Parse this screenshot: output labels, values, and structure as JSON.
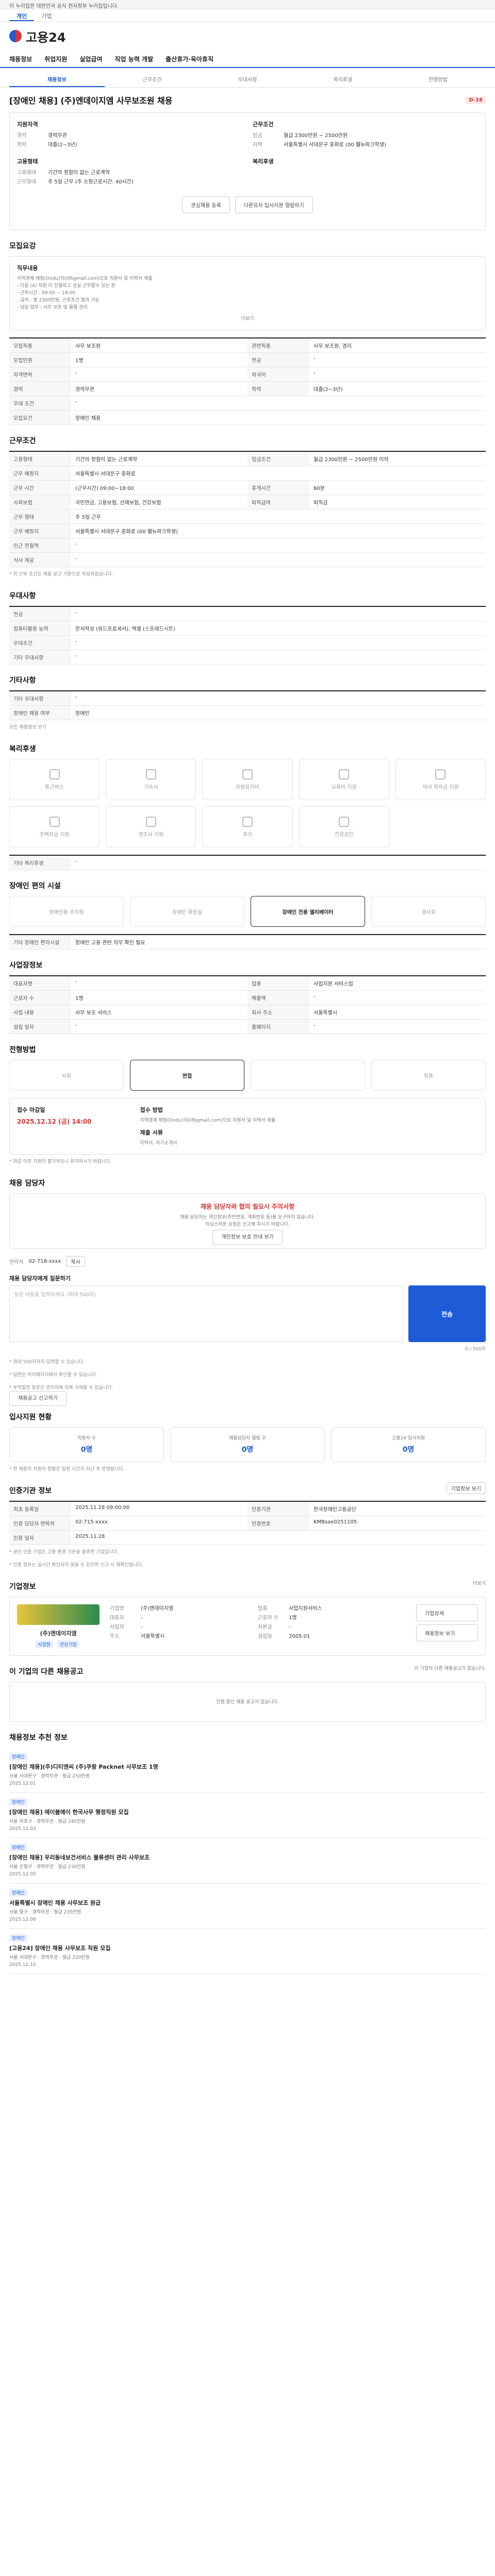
{
  "top": {
    "notice": "이 누리집은 대한민국 공식 전자정부 누리집입니다.",
    "tabs": [
      "개인",
      "기업"
    ]
  },
  "site": {
    "name": "고용24"
  },
  "gnb": [
    "채용정보",
    "취업지원",
    "실업급여",
    "직업 능력 개발",
    "출산휴가·육아휴직"
  ],
  "subtabs": [
    "채용정보",
    "근무조건",
    "우대사항",
    "복리후생",
    "전형방법"
  ],
  "job": {
    "title": "[장애인 채용] (주)엔데이지엠 사무보조원 채용",
    "badge": "D-18"
  },
  "summary": {
    "left_label": "지원자격",
    "right_label": "근무조건",
    "left": [
      [
        "경력",
        "경력무관"
      ],
      [
        "학력",
        "대졸(2~3년)"
      ]
    ],
    "right": [
      [
        "임금",
        "월급 2300만원 ~ 2500만원"
      ],
      [
        "지역",
        "서울특별시 서대문구 중화로 (00 웰뉴파크학생)"
      ]
    ],
    "left2_label": "고용형태",
    "right2_label": "복리후생",
    "left2": [
      [
        "고용형태",
        "기간의 정함이 없는 근로계약"
      ],
      [
        "근무형태",
        "주 5일 근무 (주 소정근로시간: 40시간)"
      ]
    ]
  },
  "actions": {
    "apply": "관심채용 등록",
    "share": "다른유저 입사지원 열람하기"
  },
  "sec_req": {
    "title": "모집요강",
    "duties_label": "직무내용",
    "duties": [
      "지역경제 체험(Ondu)의(lifbgmail.com)으로 지원서 및 이력서 제출",
      "- 다음 (4) 직원 이 친절하고 성실 근무할수 있는 분",
      "- 근무시간 : 09:00 ~ 18:00",
      "- 급여 : 월 2300만원, 근로조건 협의 가능",
      "- 담당 업무 : 사무 보조 및 물품 관리"
    ],
    "more": "더보기",
    "rows": [
      [
        "모집직종",
        "사무 보조원",
        "관련직종",
        "사무 보조원, 경리"
      ],
      [
        "모집인원",
        "1명",
        "전공",
        "-"
      ],
      [
        "자격면허",
        "-",
        "외국어",
        "-"
      ],
      [
        "경력",
        "경력무관",
        "학력",
        "대졸(2~3년)"
      ],
      [
        "우대 조건",
        "-",
        "",
        " "
      ],
      [
        "모집요건",
        "장애인 채용",
        "",
        ""
      ]
    ]
  },
  "sec_cond": {
    "title": "근무조건",
    "rows": [
      [
        "고용형태",
        "기간의 정함이 없는 근로계약",
        "임금조건",
        "월급 2300만원 ~ 2500만원 이하"
      ],
      [
        "근무 예정지",
        "서울특별시 서대문구 중화로",
        "",
        ""
      ],
      [
        "근무 시간",
        "(근무시간) 09:00~18:00",
        "휴게시간",
        "60분"
      ],
      [
        "사회보험",
        "국민연금, 고용보험, 산재보험, 건강보험",
        "퇴직급여",
        "퇴직금"
      ],
      [
        "근무 형태",
        "주 5일 근무",
        "",
        ""
      ],
      [
        "근무 예정지",
        "서울특별시 서대문구 중화로 (00 웰뉴파크학생)",
        "",
        ""
      ],
      [
        "인근 전철역",
        "-",
        "",
        ""
      ],
      [
        "식사 제공",
        "-",
        "",
        ""
      ]
    ],
    "note": "* 위 근무 조건은 채용 공고 기준으로 작성되었습니다."
  },
  "sec_pref": {
    "title": "우대사항",
    "rows": [
      [
        "전공",
        "-"
      ],
      [
        "컴퓨터활용 능력",
        "문서작성 (워드프로세서), 엑셀 (스프레드시트)"
      ],
      [
        "우대조건",
        "-"
      ],
      [
        "기타 우대사항",
        "-"
      ]
    ]
  },
  "sec_etc": {
    "title": "기타사항",
    "rows": [
      [
        "기타 우대사항",
        "-"
      ],
      [
        "장애인 채용 여부",
        "장애인"
      ]
    ],
    "link": "모든 채용정보 보기"
  },
  "sec_welfare": {
    "title": "복리후생",
    "items": [
      "통근버스",
      "기숙사",
      "차량유지비",
      "교육비 지원",
      "자녀 학자금 지원",
      "주택자금 지원",
      "경조사 지원",
      "휴가",
      "건강검진"
    ],
    "other_label": "기타 복리후생",
    "other_value": "-"
  },
  "sec_disab": {
    "title": "장애인 편의 시설",
    "items": [
      "장애인용 주차장",
      "장애인 화장실",
      "장애인 전용 엘리베이터",
      "경사로"
    ],
    "other_label": "기타 장애인 편의시설",
    "other_value": "장애인 고용 관련 의무 확인 필요"
  },
  "sec_co": {
    "title": "사업장정보",
    "rows": [
      [
        "대표자명",
        "-",
        "업종",
        "사업지원 서비스업"
      ],
      [
        "근로자 수",
        "1명",
        "매출액",
        "-"
      ],
      [
        "사업 내용",
        "사무 보조 서비스",
        "회사 주소",
        "서울특별시"
      ],
      [
        "설립 일자",
        "-",
        "홈페이지",
        "-"
      ]
    ]
  },
  "sec_sel": {
    "title": "전형방법",
    "steps": [
      "서류",
      "면접",
      "",
      "최종"
    ],
    "deadline_label": "접수 마감일",
    "deadline": "2025.12.12 (금) 14:00",
    "method_label": "접수 방법",
    "method": "지역경제 체험(Ondu)의(lifbgmail.com)으로 지원서 및 이력서 제출",
    "docs_label": "제출 서류",
    "docs": "이력서, 자기소개서",
    "note": "* 마감 이후 지원이 불가하오니 유의하시기 바랍니다."
  },
  "sec_contact": {
    "title": "채용 담당자",
    "alert": "채용 담당자와 협의 필요시 주의사항",
    "desc1": "채용 담당자는 개인정보(주민번호, 계좌번호 등)를 요구하지 않습니다.",
    "desc2": "의심스러운 요청은 신고해 주시기 바랍니다.",
    "btn": "개인정보 보호 안내 보기",
    "phone_label": "연락처",
    "phone": "02-718-xxxx",
    "phone_btn": "복사",
    "q_label": "채용 담당자에게 질문하기",
    "q_placeholder": "질문 내용을 입력하세요 (최대 500자)",
    "q_count": "0 / 500자",
    "send": "전송",
    "notes": [
      "* 최대 500자까지 입력할 수 있습니다.",
      "* 답변은 마이페이지에서 확인할 수 있습니다.",
      "* 부적절한 질문은 관리자에 의해 삭제될 수 있습니다."
    ],
    "guide_btn": "채용공고 신고하기"
  },
  "sec_stats": {
    "title": "입사지원 현황",
    "items": [
      [
        "지원자 수",
        "0명"
      ],
      [
        "채용담당자 열람 수",
        "0명"
      ],
      [
        "고용24 입사지원",
        "0명"
      ]
    ],
    "note": "* 현 채용의 지원자 현황은 일정 시간이 지난 후 반영됩니다."
  },
  "sec_info": {
    "title": "인증기관 정보",
    "btn": "기업정보 보기",
    "rows": [
      [
        "최초 등록일",
        "2025.11.28 09:00:00",
        "인증기관",
        "한국장애인고용공단"
      ],
      [
        "인증 담당자 연락처",
        "02-715-xxxx",
        "인증번호",
        "KMBsae0251105",
        "인증 일자",
        "2025.11.28"
      ]
    ],
    "notes": [
      "* 공단 인증 기업은 고용 환경 기준을 충족한 기업입니다.",
      "* 인증 정보는 실시간 확인되지 않을 수 있으며 신고 시 재확인됩니다."
    ]
  },
  "sec_corp": {
    "title": "기업정보",
    "more": "더보기",
    "name": "(주)엔데이지엠",
    "tags": [
      "사업장",
      "관심기업"
    ],
    "rows": [
      [
        "기업명",
        "(주)엔데이지엠",
        "업종",
        "사업지원서비스"
      ],
      [
        "대표자",
        "-",
        "근로자 수",
        "1명"
      ],
      [
        "사업자",
        "-",
        "자본금",
        "-"
      ],
      [
        "주소",
        "서울특별시",
        "설립일",
        "2005.01"
      ]
    ],
    "btns": [
      "기업상세",
      "채용정보 보기"
    ]
  },
  "sec_other": {
    "title": "이 기업의 다른 채용공고",
    "note": "이 기업의 다른 채용공고가 없습니다.",
    "empty": "진행 중인 채용 공고가 없습니다."
  },
  "sec_rec": {
    "title": "채용정보 추천 정보",
    "jobs": [
      {
        "tag": "장애인",
        "t": "[장애인 채용](주)디티엔씨 (주)쿠팡 Packnet 사무보조 1명",
        "d": "서울 서대문구 · 경력무관 · 월급 250만원",
        "date": "2025.12.01"
      },
      {
        "tag": "장애인",
        "t": "[장애인 채용] 에이블에이 한국사무 행정직원 모집",
        "d": "서울 마포구 · 경력무관 · 월급 240만원",
        "date": "2025.12.03"
      },
      {
        "tag": "장애인",
        "t": "[장애인 채용] 우리동네보건서비스 물류센터 관리 사무보조",
        "d": "서울 은평구 · 경력무관 · 월급 230만원",
        "date": "2025.12.05"
      },
      {
        "tag": "장애인",
        "t": "서울특별시 장애인 채용 사무보조 원급",
        "d": "서울 중구 · 경력무관 · 월급 235만원",
        "date": "2025.12.08"
      },
      {
        "tag": "장애인",
        "t": "[고용24] 장애인 채용 사무보조 직원 모집",
        "d": "서울 서대문구 · 경력무관 · 월급 220만원",
        "date": "2025.12.10"
      }
    ]
  }
}
